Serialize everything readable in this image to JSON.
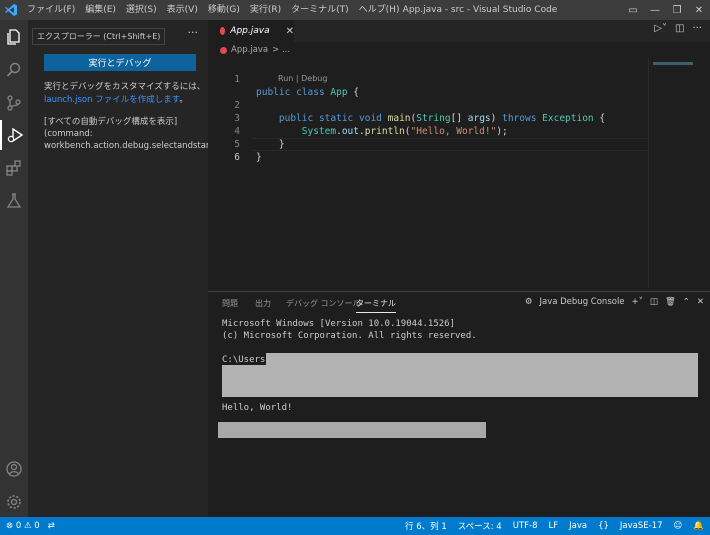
{
  "titlebar": {
    "logo": "VS",
    "menu": [
      "ファイル(F)",
      "編集(E)",
      "選択(S)",
      "表示(V)",
      "移動(G)",
      "実行(R)",
      "ターミナル(T)",
      "ヘルプ(H)"
    ],
    "title": "App.java - src - Visual Studio Code"
  },
  "sidebar": {
    "tooltip": "エクスプローラー (Ctrl+Shift+E)",
    "more": "···",
    "run_button": "実行とデバッグ",
    "text1": "実行とデバッグをカスタマイズするには、",
    "link_file": "launch.json",
    "link_action": "ファイルを作成します",
    "text_end": "。",
    "text2": "[すべての自動デバッグ構成を表示]",
    "text3": "(command:",
    "text4": "workbench.action.debug.selectandstart)。"
  },
  "editor": {
    "tab_name": "App.java",
    "breadcrumb_file": "App.java",
    "breadcrumb_rest": "> ...",
    "codelens": "Run | Debug",
    "line_numbers": [
      "1",
      "2",
      "3",
      "4",
      "5",
      "6"
    ]
  },
  "panel": {
    "tabs": [
      "問題",
      "出力",
      "デバッグ コンソール",
      "ターミナル"
    ],
    "console_label": "Java Debug Console",
    "terminal_lines": [
      "Microsoft Windows [Version 10.0.19044.1526]",
      "(c) Microsoft Corporation. All rights reserved.",
      "",
      "C:\\Users",
      "",
      "",
      "",
      "Hello, World!"
    ]
  },
  "statusbar": {
    "errors": "0",
    "warnings": "0",
    "position": "行 6、列 1",
    "spaces": "スペース: 4",
    "encoding": "UTF-8",
    "eol": "LF",
    "language": "Java",
    "jdk": "JavaSE-17"
  }
}
